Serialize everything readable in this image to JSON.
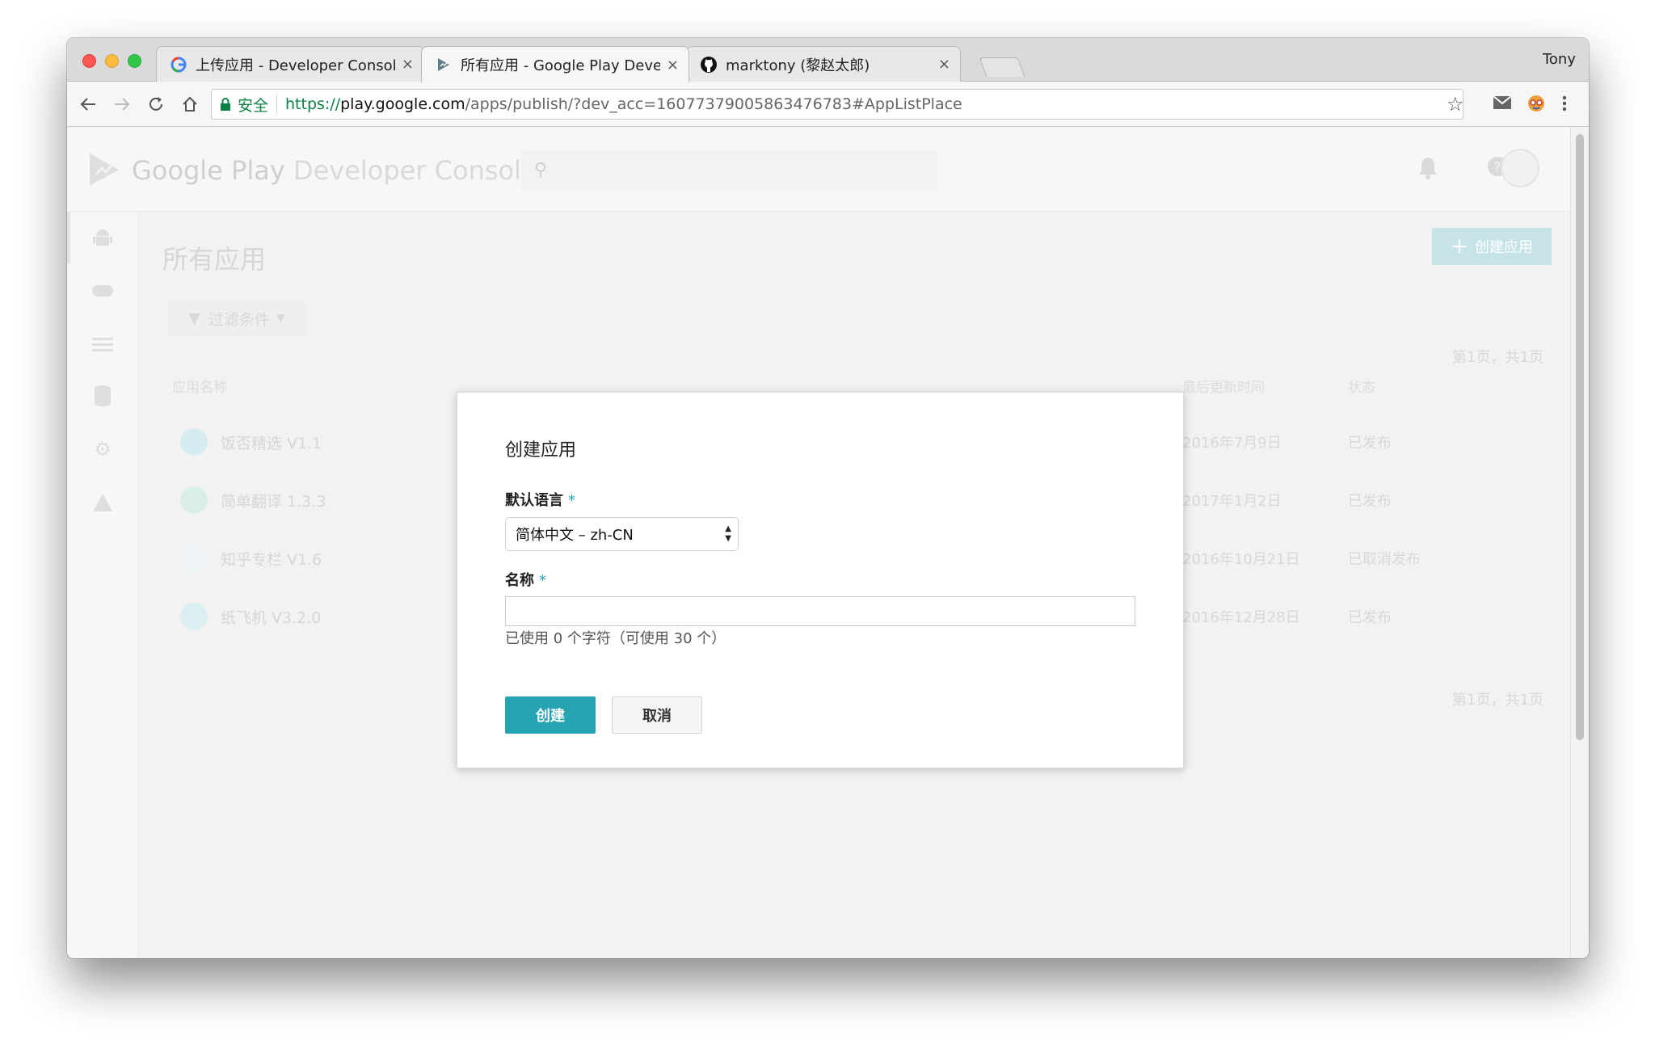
{
  "browser": {
    "tabs": [
      {
        "title": "上传应用 - Developer Console",
        "close": "×"
      },
      {
        "title": "所有应用 - Google Play Developer Console",
        "close": "×"
      },
      {
        "title": "marktony (黎赵太郎)",
        "close": "×"
      }
    ],
    "profile": "Tony",
    "address": {
      "secure_label": "安全",
      "scheme": "https://",
      "host": "play.google.com",
      "path": "/apps/publish/?dev_acc=16077379005863476783#AppListPlace"
    }
  },
  "header": {
    "logo_text": "Google Play",
    "logo_sub": "Developer Console"
  },
  "page": {
    "title": "所有应用",
    "create_button": "创建应用",
    "pager_top": "第1页，共1页",
    "pager_bottom": "第1页，共1页",
    "filter_label": "过滤条件",
    "columns": {
      "name": "应用名称",
      "updated": "最后更新时间",
      "status": "状态"
    },
    "apps": [
      {
        "name": "饭否精选 V1.1",
        "updated": "2016年7月9日",
        "status": "已发布"
      },
      {
        "name": "简单翻译 1.3.3",
        "updated": "2017年1月2日",
        "status": "已发布"
      },
      {
        "name": "知乎专栏 V1.6",
        "updated": "2016年10月21日",
        "status": "已取消发布"
      },
      {
        "name": "纸飞机 V3.2.0",
        "updated": "2016年12月28日",
        "status": "已发布"
      }
    ]
  },
  "modal": {
    "title": "创建应用",
    "language_label": "默认语言",
    "required_mark": "*",
    "language_value": "简体中文 – zh-CN",
    "name_label": "名称",
    "name_value": "",
    "char_count": "已使用 0 个字符（可使用 30 个）",
    "create_button": "创建",
    "cancel_button": "取消"
  },
  "colors": {
    "accent": "#26a4b2",
    "secure_green": "#0b8043"
  },
  "icons": {
    "back": "arrow-left-icon",
    "forward": "arrow-right-icon",
    "reload": "reload-icon",
    "home": "home-icon",
    "bookmark": "star-icon",
    "mail": "mail-icon",
    "extension": "extension-icon",
    "menu": "kebab-menu-icon"
  }
}
